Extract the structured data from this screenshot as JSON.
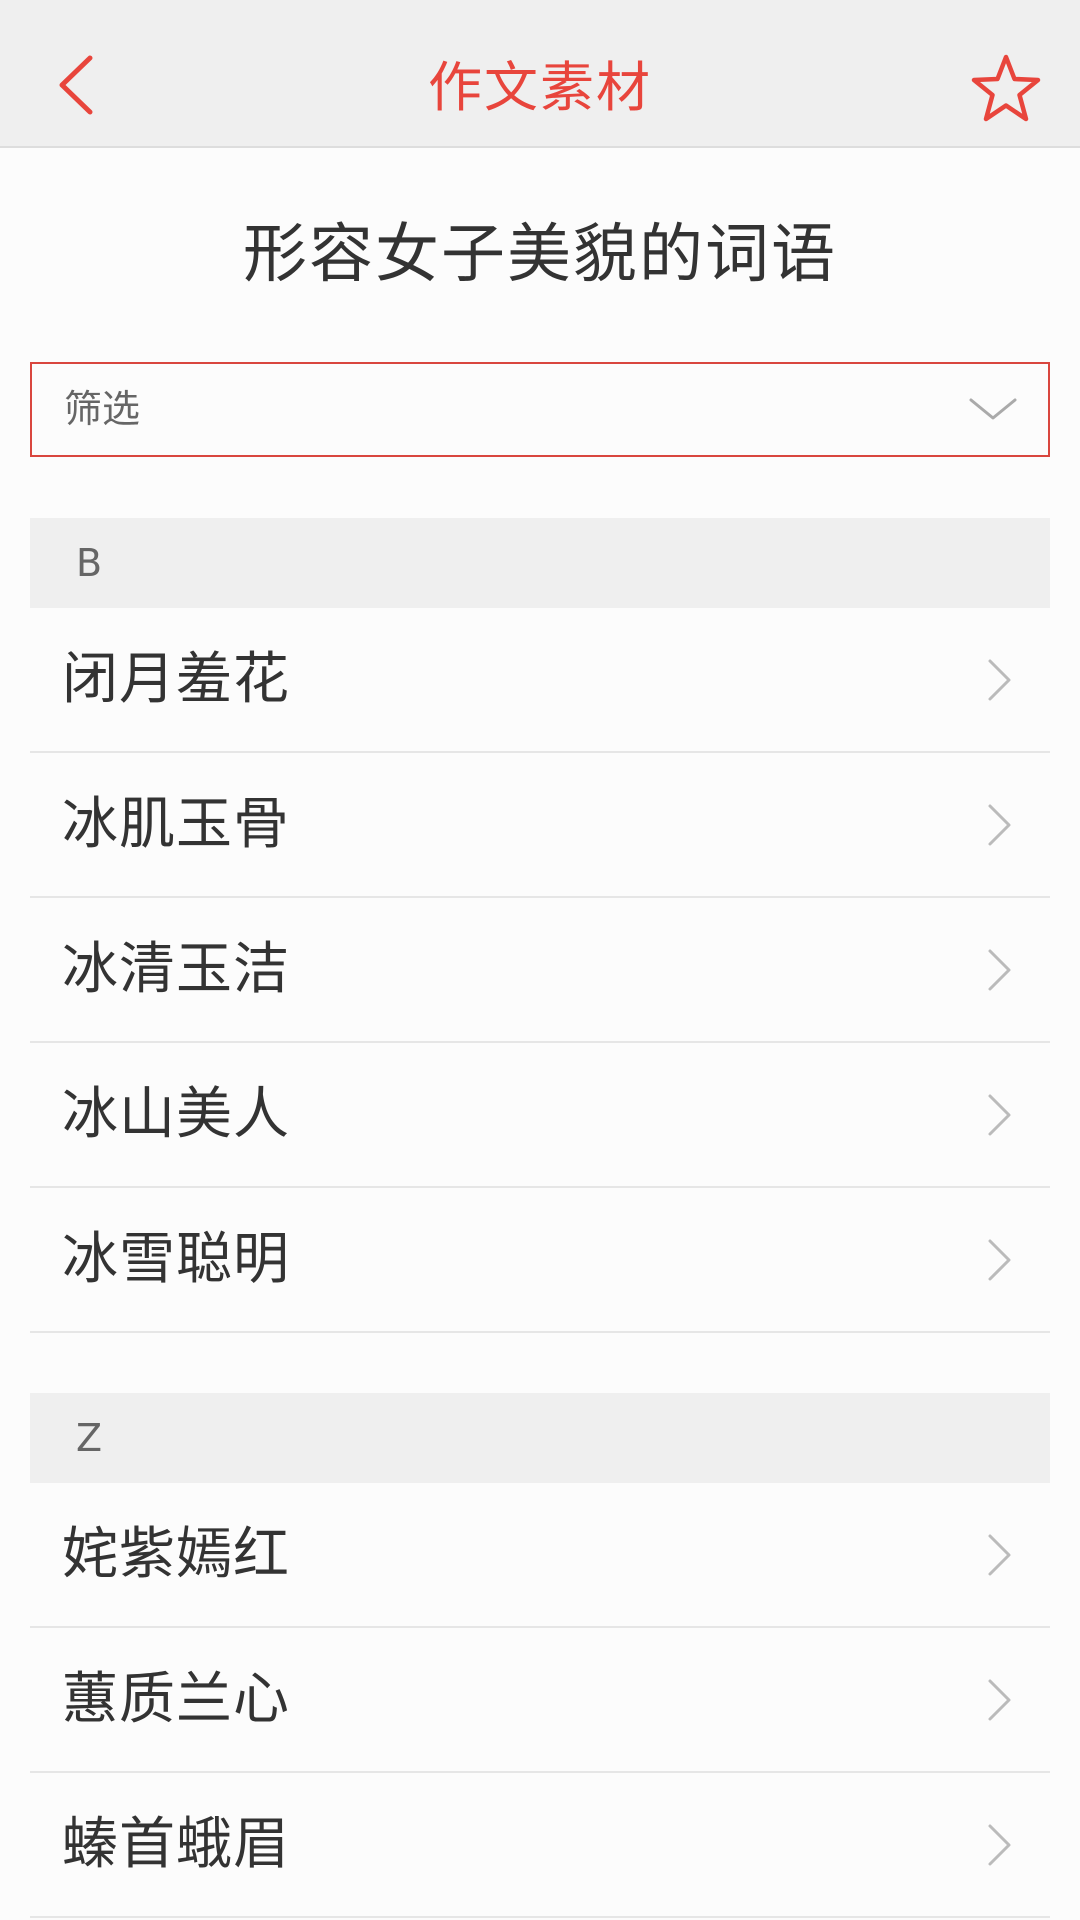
{
  "header": {
    "title": "作文素材",
    "back_icon": "chevron-left-icon",
    "favorite_icon": "star-outline-icon",
    "accent_color": "#e8453c"
  },
  "page": {
    "title": "形容女子美貌的词语"
  },
  "filter": {
    "label": "筛选",
    "icon": "chevron-down-icon"
  },
  "sections": [
    {
      "letter": "B",
      "items": [
        "闭月羞花",
        "冰肌玉骨",
        "冰清玉洁",
        "冰山美人",
        "冰雪聪明"
      ]
    },
    {
      "letter": "Z",
      "items": [
        "姹紫嫣红",
        "蕙质兰心",
        "螓首蛾眉"
      ]
    }
  ]
}
